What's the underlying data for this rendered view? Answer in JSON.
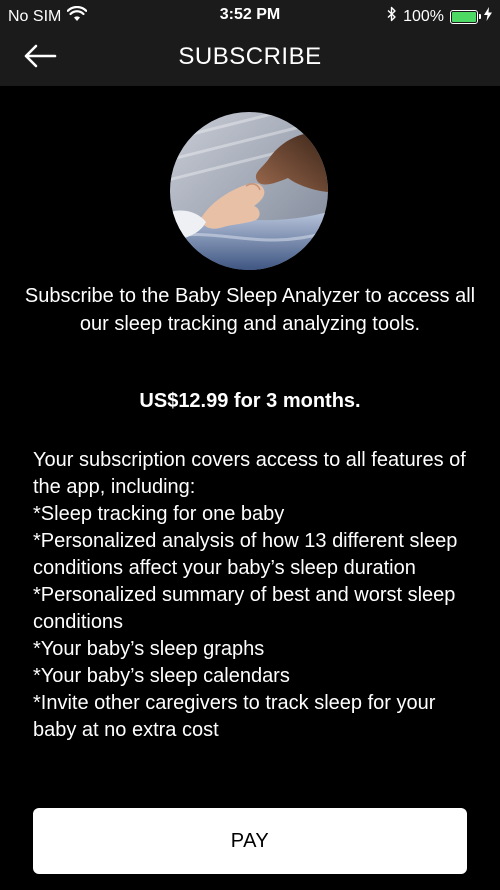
{
  "status_bar": {
    "carrier": "No SIM",
    "time": "3:52 PM",
    "battery_percent": "100%",
    "battery_level": 1.0,
    "battery_color": "#4cd964"
  },
  "header": {
    "title": "SUBSCRIBE",
    "back_icon": "arrow-left-icon"
  },
  "hero": {
    "icon": "baby-hand-photo"
  },
  "content": {
    "intro": "Subscribe to the Baby Sleep Analyzer to access all our sleep tracking and analyzing tools.",
    "price": "US$12.99 for 3 months.",
    "features": [
      "Your subscription covers access to all features of the app, including:",
      "*Sleep tracking for one baby",
      "*Personalized analysis of how 13 different sleep conditions affect your baby’s sleep duration",
      "*Personalized summary of best and worst sleep conditions",
      "*Your baby’s sleep graphs",
      "*Your baby’s sleep calendars",
      "*Invite other caregivers to track sleep for your baby at no extra cost"
    ]
  },
  "pay_button": {
    "label": "PAY"
  }
}
